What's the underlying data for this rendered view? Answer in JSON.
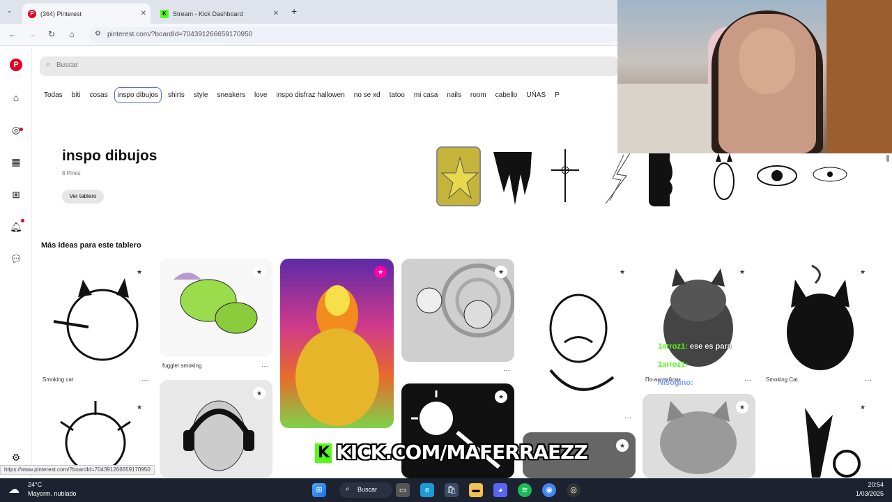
{
  "browser": {
    "tabs": [
      {
        "title": "(364) Pinterest",
        "favicon_color": "#e60023"
      },
      {
        "title": "Stream - Kick Dashboard",
        "favicon_color": "#53fc18"
      }
    ],
    "url": "pinterest.com/?boardId=704391266659170950",
    "status_url": "https://www.pinterest.com/?boardId=704391266659170950"
  },
  "pinterest": {
    "search_placeholder": "Buscar",
    "boards": [
      "Todas",
      "biti",
      "cosas",
      "inspo dibujos",
      "shirts",
      "style",
      "sneakers",
      "love",
      "inspo disfraz hallowen",
      "no se xd",
      "tatoo",
      "mi casa",
      "nails",
      "room",
      "cabello",
      "UÑAS",
      "P"
    ],
    "selected_board_index": 3,
    "board": {
      "title": "inspo dibujos",
      "pin_count": "8 Pines",
      "view_button": "Ver tablero"
    },
    "more_ideas_title": "Más ideas para este tablero",
    "pins": [
      {
        "caption": "Smoking cat"
      },
      {
        "caption": "fuggler smoking"
      },
      {
        "caption": "По-английски"
      },
      {
        "caption": "Smoking Cat"
      }
    ]
  },
  "stream": {
    "chat": [
      {
        "user": "1arroz1:",
        "message": "ese es para",
        "color": "#53fc18"
      },
      {
        "user": "1arroz1:",
        "message": "",
        "color": "#53fc18"
      },
      {
        "user": "Nisogino:",
        "message": "",
        "color": "#7a9cff"
      }
    ],
    "kick_banner": "KICK.COM/MAFERRAEZZ"
  },
  "taskbar": {
    "weather_temp": "24°C",
    "weather_desc": "Mayorm. nublado",
    "search_label": "Buscar",
    "time": "20:54",
    "date": "1/03/2025"
  }
}
